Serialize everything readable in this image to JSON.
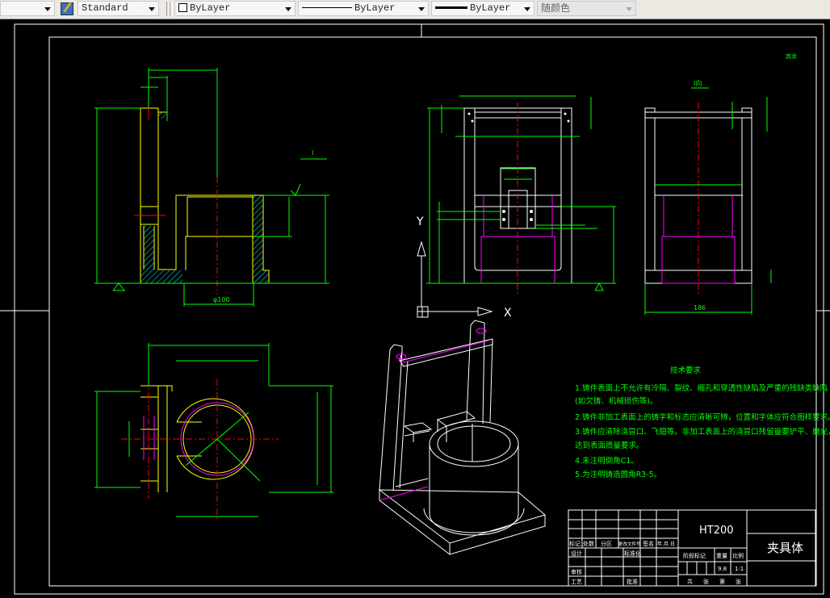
{
  "toolbar": {
    "layer_combo": "",
    "text_style_icon": "text-style-icon",
    "text_style": "Standard",
    "color": "ByLayer",
    "linetype": "ByLayer",
    "lineweight": "ByLayer",
    "plot_style": "随颜色"
  },
  "ucs": {
    "x_label": "X",
    "y_label": "Y"
  },
  "views": {
    "section_mark": "I",
    "side_view_title": "I向",
    "dim_bore": "φ100",
    "dim_width": "186",
    "roughness_note": "其余"
  },
  "tech_requirements": {
    "title": "技术要求",
    "lines": [
      "1.铸件表面上不允许有冷隔、裂纹、缩孔和穿透性缺陷及严重的残缺类缺陷",
      "(如欠铸、机械损伤等)。",
      "2.铸件非加工表面上的铸字和标志应清晰可辨，位置和字体应符合图样要求。",
      "3.铸件应清除浇冒口、飞翅等。非加工表面上的浇冒口残留量要铲平、磨光，",
      "达到表面质量要求。",
      "4.未注明倒角C1。",
      "5.为注明铸造圆角R3-5。"
    ]
  },
  "title_block": {
    "material": "HT200",
    "part_name": "夹具体",
    "rev_headers": [
      "标记",
      "处数",
      "分区",
      "更改文件号",
      "签名",
      "年.月.日"
    ],
    "design": "设计",
    "standardization": "标准化",
    "review": "审核",
    "process": "工艺",
    "approve": "批准",
    "stage_mark": "阶段标记",
    "weight_label": "重量",
    "scale_label": "比例",
    "weight": "9.8",
    "scale": "1:1",
    "sheet_total": "共",
    "sheet_unit1": "张",
    "sheet_no": "第",
    "sheet_unit2": "张"
  },
  "colors": {
    "background": "#000000",
    "outline": "#ffff00",
    "dimension": "#00ff00",
    "center": "#ff0000",
    "hidden": "#ff00ff",
    "white": "#ffffff",
    "hatch": "#00ffff"
  }
}
